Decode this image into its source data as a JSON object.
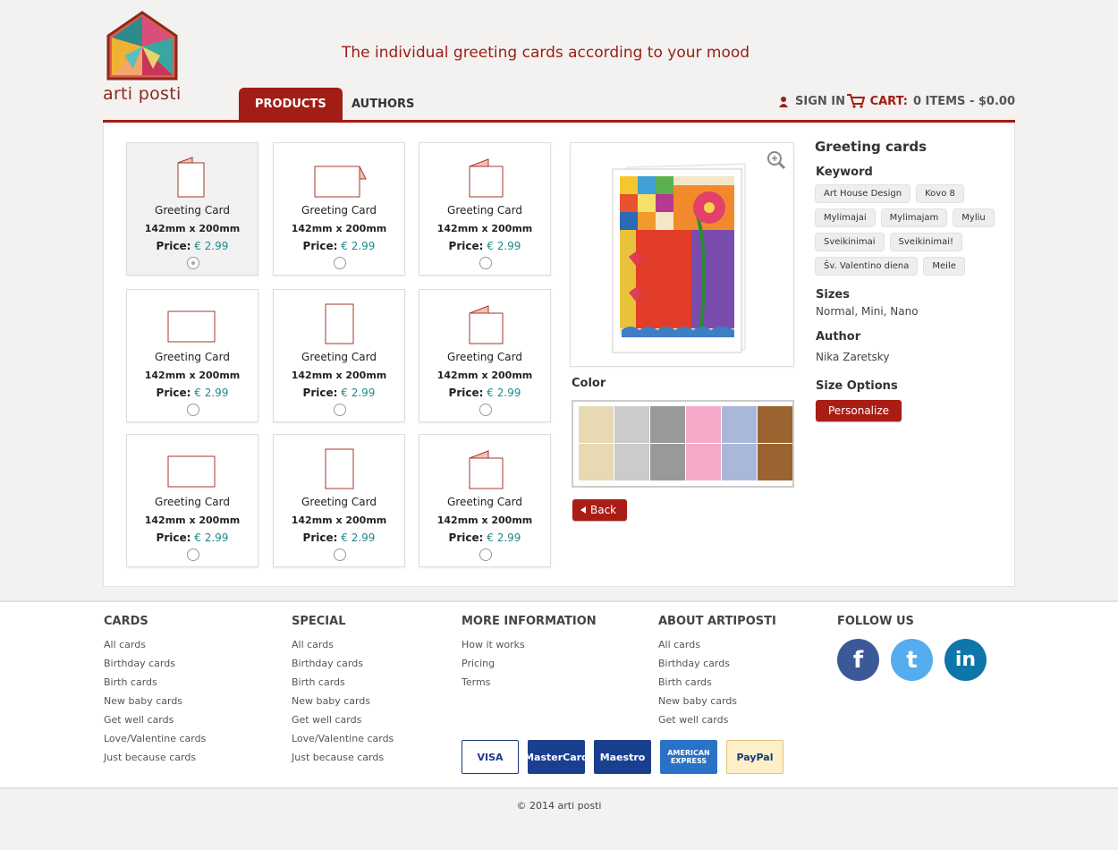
{
  "header": {
    "logo_text": "arti posti",
    "tagline": "The individual greeting cards according to your mood"
  },
  "nav": {
    "tabs": [
      {
        "label": "PRODUCTS",
        "active": true
      },
      {
        "label": "AUTHORS",
        "active": false
      }
    ],
    "sign_in": "SIGN IN",
    "cart_label": "CART:",
    "cart_value": "0 ITEMS - $0.00"
  },
  "cards": [
    {
      "shape": "folded-portrait",
      "name": "Greeting Card",
      "size": "142mm x 200mm",
      "price_label": "Price:",
      "price": "€ 2.99",
      "selected": true
    },
    {
      "shape": "folded-landscape",
      "name": "Greeting Card",
      "size": "142mm x 200mm",
      "price_label": "Price:",
      "price": "€ 2.99",
      "selected": false
    },
    {
      "shape": "folded-top",
      "name": "Greeting Card",
      "size": "142mm x 200mm",
      "price_label": "Price:",
      "price": "€ 2.99",
      "selected": false
    },
    {
      "shape": "flat-landscape",
      "name": "Greeting Card",
      "size": "142mm x 200mm",
      "price_label": "Price:",
      "price": "€ 2.99",
      "selected": false
    },
    {
      "shape": "flat-portrait",
      "name": "Greeting Card",
      "size": "142mm x 200mm",
      "price_label": "Price:",
      "price": "€ 2.99",
      "selected": false
    },
    {
      "shape": "folded-top",
      "name": "Greeting Card",
      "size": "142mm x 200mm",
      "price_label": "Price:",
      "price": "€ 2.99",
      "selected": false
    },
    {
      "shape": "flat-landscape",
      "name": "Greeting Card",
      "size": "142mm x 200mm",
      "price_label": "Price:",
      "price": "€ 2.99",
      "selected": false
    },
    {
      "shape": "flat-portrait",
      "name": "Greeting Card",
      "size": "142mm x 200mm",
      "price_label": "Price:",
      "price": "€ 2.99",
      "selected": false
    },
    {
      "shape": "folded-top",
      "name": "Greeting Card",
      "size": "142mm x 200mm",
      "price_label": "Price:",
      "price": "€ 2.99",
      "selected": false
    }
  ],
  "preview": {
    "color_title": "Color",
    "colors": [
      "#e8d9b5",
      "#cbcbcb",
      "#999999",
      "#f6a9c8",
      "#a9b8d9",
      "#9a6430",
      "#e8d9b5",
      "#cbcbcb",
      "#999999",
      "#f6a9c8",
      "#a9b8d9",
      "#9a6430"
    ],
    "back_label": "Back"
  },
  "info": {
    "title": "Greeting cards",
    "keyword_title": "Keyword",
    "keywords": [
      "Art House Design",
      "Kovo 8",
      "Mylimajai",
      "Mylimajam",
      "Myliu",
      "Sveikinimai",
      "Sveikinimai!",
      "Šv. Valentino diena",
      "Meile"
    ],
    "sizes_title": "Sizes",
    "sizes": "Normal, Mini, Nano",
    "author_title": "Author",
    "author": "Nika Zaretsky",
    "size_options_title": "Size Options",
    "personalize": "Personalize"
  },
  "footer": {
    "columns": [
      {
        "title": "CARDS",
        "links": [
          "All cards",
          "Birthday cards",
          "Birth cards",
          "New baby cards",
          "Get well cards",
          "Love/Valentine cards",
          "Just because cards"
        ]
      },
      {
        "title": "SPECIAL",
        "links": [
          "All cards",
          "Birthday cards",
          "Birth cards",
          "New baby cards",
          "Get well cards",
          "Love/Valentine cards",
          "Just because cards"
        ]
      },
      {
        "title": "MORE INFORMATION",
        "links": [
          "How it works",
          "Pricing",
          "Terms"
        ]
      },
      {
        "title": "ABOUT ARTIPOSTI",
        "links": [
          "All cards",
          "Birthday cards",
          "Birth cards",
          "New baby cards",
          "Get well cards"
        ]
      }
    ],
    "follow_title": "FOLLOW US",
    "social": [
      {
        "icon": "facebook-icon",
        "glyph": "f",
        "color": "#3b5998"
      },
      {
        "icon": "twitter-icon",
        "glyph": "t",
        "color": "#55acee"
      },
      {
        "icon": "linkedin-icon",
        "glyph": "in",
        "color": "#0e76a8"
      }
    ],
    "payments": [
      "VISA",
      "MasterCard",
      "Maestro",
      "AMERICAN EXPRESS",
      "PayPal"
    ],
    "copyright": "© 2014 arti posti"
  }
}
